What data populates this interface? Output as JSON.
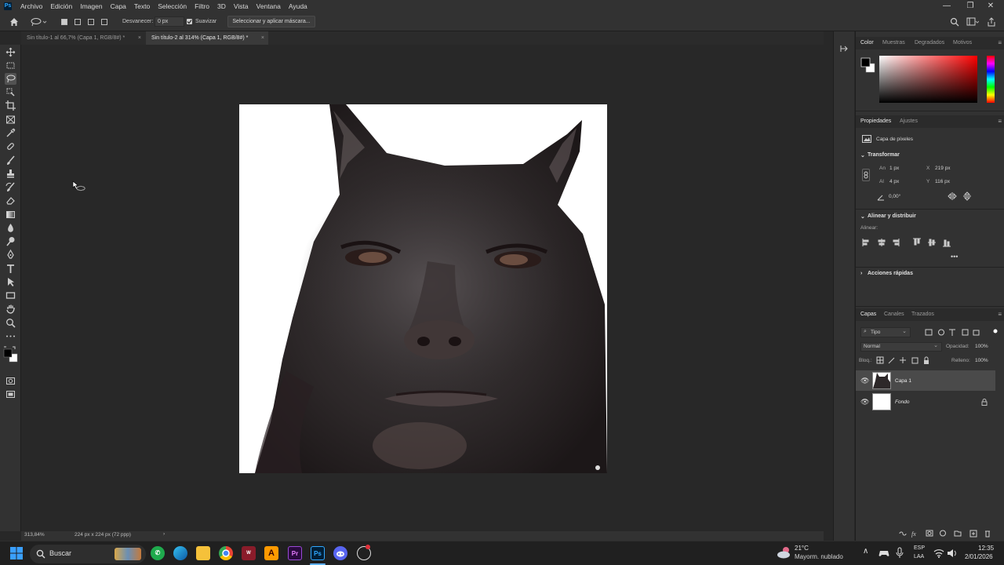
{
  "menubar": {
    "logo": "Ps",
    "items": [
      "Archivo",
      "Edición",
      "Imagen",
      "Capa",
      "Texto",
      "Selección",
      "Filtro",
      "3D",
      "Vista",
      "Ventana",
      "Ayuda"
    ],
    "window_controls": [
      "—",
      "❐",
      "✕"
    ]
  },
  "optionsbar": {
    "feather_label": "Desvanecer:",
    "feather_value": "0 px",
    "antialias_label": "Suavizar",
    "select_mask_label": "Seleccionar y aplicar máscara..."
  },
  "tabs": [
    {
      "label": "Sin título-1 al 66,7% (Capa 1, RGB/8#) *",
      "active": false
    },
    {
      "label": "Sin título-2 al 314% (Capa 1, RGB/8#) *",
      "active": true
    }
  ],
  "status": {
    "zoom": "313,84%",
    "doc_size": "224 px x 224 px (72 ppp)",
    "arrow": "›"
  },
  "panels": {
    "color_tabs": [
      "Color",
      "Muestras",
      "Degradados",
      "Motivos"
    ],
    "props_tabs": [
      "Propiedades",
      "Ajustes"
    ],
    "pixel_layer_label": "Capa de píxeles",
    "transform": {
      "title": "Transformar",
      "w_label": "An",
      "w_value": "1 px",
      "h_label": "Al",
      "h_value": "4 px",
      "x_label": "X",
      "x_value": "219 px",
      "y_label": "Y",
      "y_value": "116 px",
      "angle_value": "0,00°"
    },
    "align": {
      "title": "Alinear y distribuir",
      "sub": "Alinear:"
    },
    "quick_actions": "Acciones rápidas",
    "layers_tabs": [
      "Capas",
      "Canales",
      "Trazados"
    ],
    "filter_label": "Tipo",
    "blend_mode": "Normal",
    "opacity_label": "Opacidad:",
    "opacity_value": "100%",
    "lock_label": "Bloq.:",
    "fill_label": "Relleno:",
    "fill_value": "100%",
    "layers": [
      {
        "name": "Capa 1",
        "selected": true,
        "locked": false
      },
      {
        "name": "Fondo",
        "selected": false,
        "locked": true
      }
    ]
  },
  "taskbar": {
    "search_placeholder": "Buscar",
    "weather_temp": "21°C",
    "weather_desc": "Mayorm. nublado",
    "lang_1": "ESP",
    "lang_2": "LAA",
    "time": "12:35",
    "date": "2/01/2026",
    "apps": [
      "whatsapp",
      "edge",
      "explorer",
      "chrome",
      "winrar",
      "illustrator",
      "premiere",
      "photoshop",
      "discord",
      "chatgpt"
    ]
  },
  "colors": {
    "accent": "#31a8ff",
    "panel": "#323232",
    "canvas": "#282828",
    "hue_top": "#ff0000"
  }
}
